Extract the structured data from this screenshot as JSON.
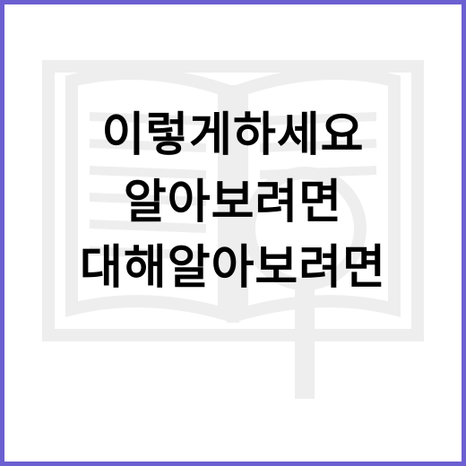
{
  "title_lines": [
    "이렇게하세요",
    "알아보려면",
    "대해알아보려면"
  ],
  "colors": {
    "border": "#6c5fd1",
    "text": "#000000",
    "watermark": "#eeeeee",
    "background": "#ffffff"
  },
  "icons": {
    "background": "open-book-magnifier-icon"
  }
}
